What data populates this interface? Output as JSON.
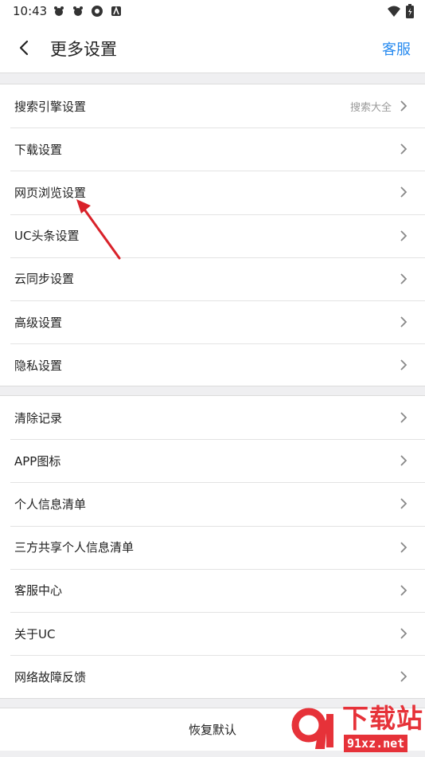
{
  "status_bar": {
    "time": "10:43"
  },
  "header": {
    "title": "更多设置",
    "service_link": "客服"
  },
  "group1": [
    {
      "label": "搜索引擎设置",
      "value": "搜索大全"
    },
    {
      "label": "下载设置"
    },
    {
      "label": "网页浏览设置"
    },
    {
      "label": "UC头条设置"
    },
    {
      "label": "云同步设置"
    },
    {
      "label": "高级设置"
    },
    {
      "label": "隐私设置"
    }
  ],
  "group2": [
    {
      "label": "清除记录"
    },
    {
      "label": "APP图标"
    },
    {
      "label": "个人信息清单"
    },
    {
      "label": "三方共享个人信息清单"
    },
    {
      "label": "客服中心"
    },
    {
      "label": "关于UC"
    },
    {
      "label": "网络故障反馈"
    }
  ],
  "restore_label": "恢复默认",
  "watermark": {
    "title": "下载站",
    "sub": "91xz.net"
  },
  "colors": {
    "accent": "#2a8cf0",
    "annotation": "#d9222a",
    "watermark": "#e63239"
  }
}
